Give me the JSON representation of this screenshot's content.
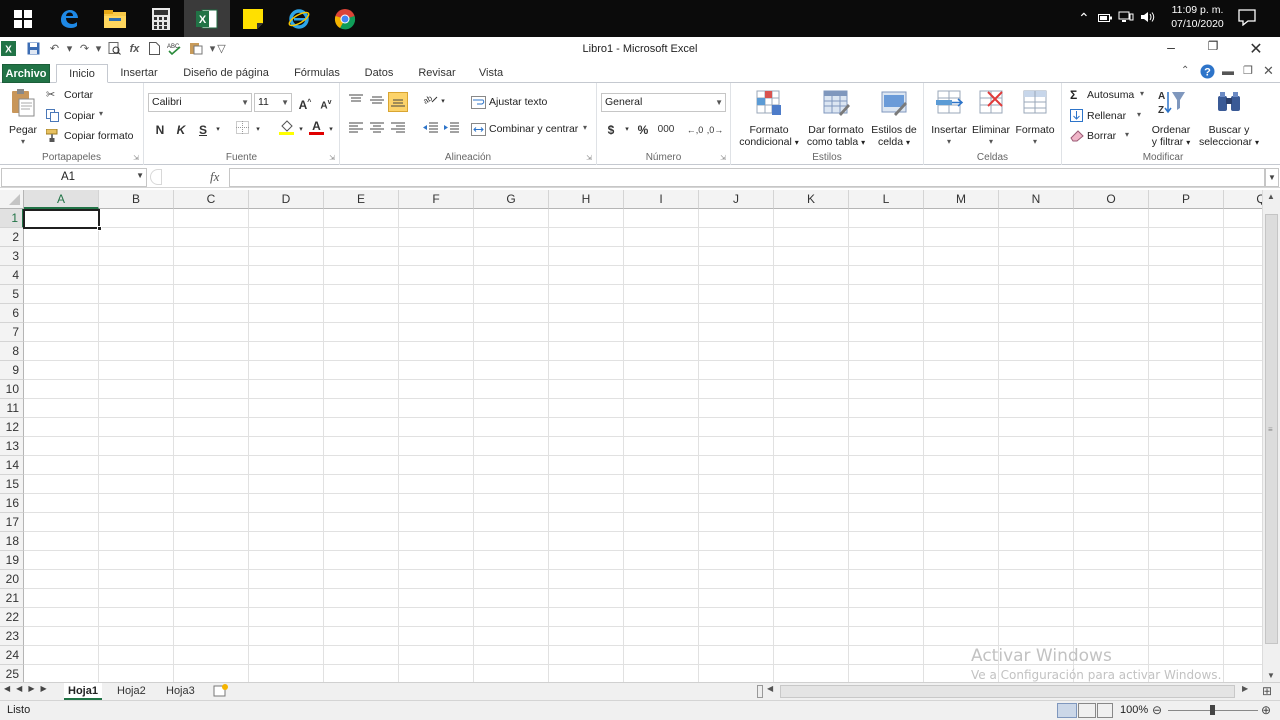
{
  "taskbar": {
    "apps": [
      "start-button",
      "edge-legacy",
      "file-explorer",
      "calculator",
      "excel",
      "sticky-notes",
      "internet-explorer",
      "chrome"
    ],
    "time": "11:09 p. m.",
    "date": "07/10/2020"
  },
  "window": {
    "title": "Libro1  -  Microsoft Excel"
  },
  "tabs": [
    "Archivo",
    "Inicio",
    "Insertar",
    "Diseño de página",
    "Fórmulas",
    "Datos",
    "Revisar",
    "Vista"
  ],
  "ribbon": {
    "clipboard": {
      "paste": "Pegar",
      "cut": "Cortar",
      "copy": "Copiar",
      "format_painter": "Copiar formato",
      "label": "Portapapeles"
    },
    "font": {
      "name": "Calibri",
      "size": "11",
      "bold": "N",
      "italic": "K",
      "underline": "S",
      "label": "Fuente"
    },
    "alignment": {
      "wrap": "Ajustar texto",
      "merge": "Combinar y centrar",
      "label": "Alineación"
    },
    "number": {
      "format": "General",
      "currency": "$",
      "percent": "%",
      "thousands": "000",
      "label": "Número"
    },
    "styles": {
      "conditional_1": "Formato",
      "conditional_2": "condicional",
      "table_1": "Dar formato",
      "table_2": "como tabla",
      "cell_1": "Estilos de",
      "cell_2": "celda",
      "label": "Estilos"
    },
    "cells": {
      "insert": "Insertar",
      "delete": "Eliminar",
      "format": "Formato",
      "label": "Celdas"
    },
    "editing": {
      "autosum": "Autosuma",
      "fill": "Rellenar",
      "clear": "Borrar",
      "sort_1": "Ordenar",
      "sort_2": "y filtrar",
      "find_1": "Buscar y",
      "find_2": "seleccionar",
      "label": "Modificar"
    }
  },
  "formula_bar": {
    "name_box": "A1",
    "fx": "fx",
    "value": ""
  },
  "grid": {
    "columns": [
      "A",
      "B",
      "C",
      "D",
      "E",
      "F",
      "G",
      "H",
      "I",
      "J",
      "K",
      "L",
      "M",
      "N",
      "O",
      "P",
      "Q"
    ],
    "rows": [
      "1",
      "2",
      "3",
      "4",
      "5",
      "6",
      "7",
      "8",
      "9",
      "10",
      "11",
      "12",
      "13",
      "14",
      "15",
      "16",
      "17",
      "18",
      "19",
      "20",
      "21",
      "22",
      "23",
      "24",
      "25"
    ],
    "active_cell": "A1"
  },
  "sheets": [
    "Hoja1",
    "Hoja2",
    "Hoja3"
  ],
  "status": {
    "text": "Listo",
    "zoom": "100%"
  },
  "watermark": {
    "line1": "Activar Windows",
    "line2": "Ve a Configuración para activar Windows."
  },
  "colors": {
    "accent": "#217346",
    "taskbar": "#0b0b0b"
  }
}
